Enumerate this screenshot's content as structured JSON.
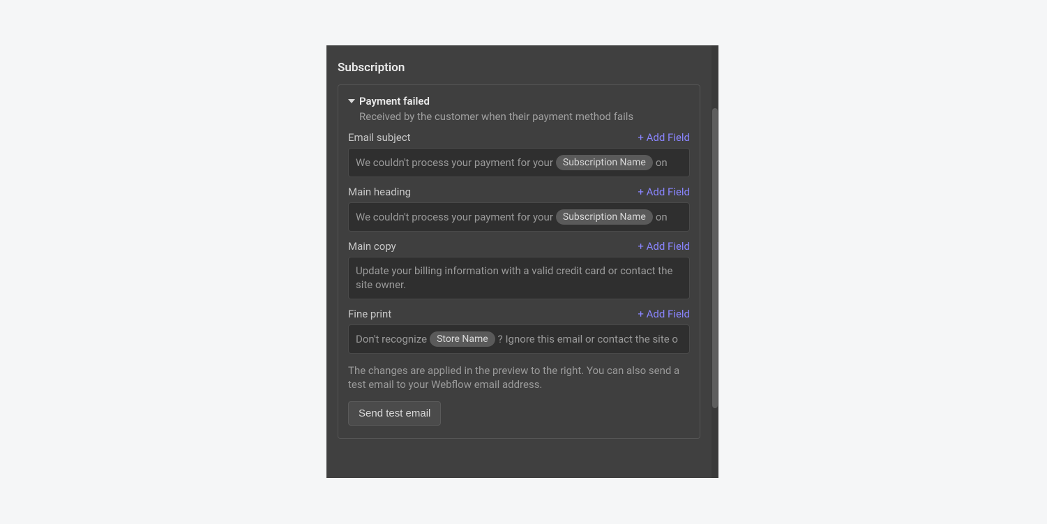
{
  "section_title": "Subscription",
  "card": {
    "title": "Payment failed",
    "description": "Received by the customer when their payment method fails"
  },
  "add_field_label": "+ Add Field",
  "fields": {
    "email_subject": {
      "label": "Email subject",
      "text_before": "We couldn't process your payment for your ",
      "chip": "Subscription Name",
      "text_after": " on"
    },
    "main_heading": {
      "label": "Main heading",
      "text_before": "We couldn't process your payment for your ",
      "chip": "Subscription Name",
      "text_after": " on"
    },
    "main_copy": {
      "label": "Main copy",
      "text": "Update your billing information with a valid credit card or contact the site owner."
    },
    "fine_print": {
      "label": "Fine print",
      "text_before": "Don't recognize ",
      "chip": "Store Name",
      "text_after": "? Ignore this email or contact the site o"
    }
  },
  "note": "The changes are applied in the preview to the right. You can also send a test email to your Webflow email address.",
  "send_button": "Send test email"
}
